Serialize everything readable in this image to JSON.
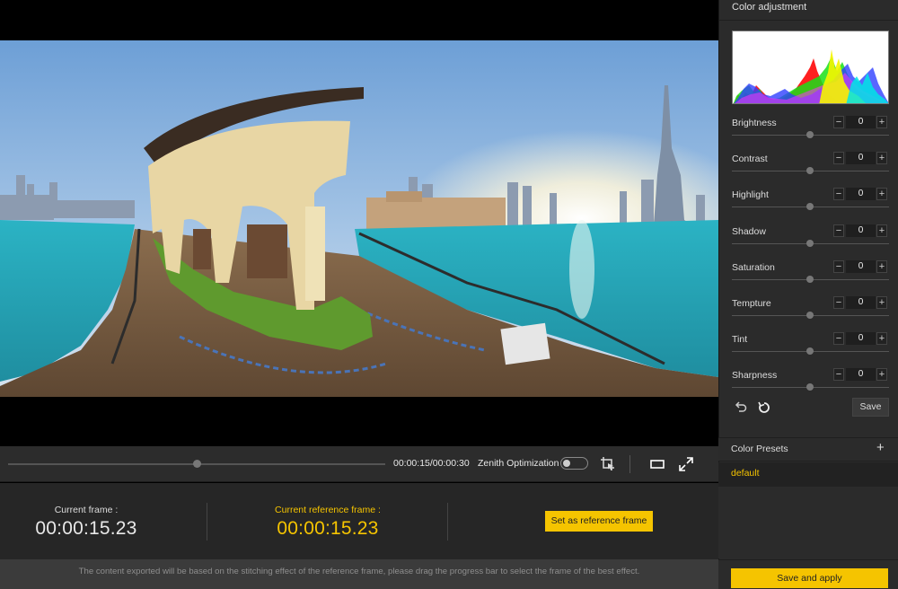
{
  "player": {
    "timecode": "00:00:15/00:00:30",
    "progress_fraction": 0.5,
    "zenith_label": "Zenith Optimization",
    "zenith_enabled": false
  },
  "frames": {
    "current_label": "Current frame :",
    "current_time": "00:00:15.23",
    "reference_label": "Current reference frame :",
    "reference_time": "00:00:15.23",
    "set_reference_button": "Set as reference frame"
  },
  "notice": "The content exported will be based on the stitching effect of the reference frame, please drag the progress bar to select the frame of the best effect.",
  "color_adjustment": {
    "title": "Color adjustment",
    "controls": [
      {
        "label": "Brightness",
        "value": "0"
      },
      {
        "label": "Contrast",
        "value": "0"
      },
      {
        "label": "Highlight",
        "value": "0"
      },
      {
        "label": "Shadow",
        "value": "0"
      },
      {
        "label": "Saturation",
        "value": "0"
      },
      {
        "label": "Tempture",
        "value": "0"
      },
      {
        "label": "Tint",
        "value": "0"
      },
      {
        "label": "Sharpness",
        "value": "0"
      }
    ],
    "minus_symbol": "−",
    "plus_symbol": "+",
    "save_button": "Save"
  },
  "color_presets": {
    "title": "Color Presets",
    "add_symbol": "+",
    "items": [
      "default"
    ]
  },
  "save_apply_button": "Save and apply",
  "colors": {
    "accent": "#f5c400",
    "panel": "#2b2b2b",
    "water": "#2aa8b8",
    "sky": "#7fb0e0"
  },
  "icons": [
    "crop-select-icon",
    "screen-icon",
    "fullscreen-icon",
    "undo-icon",
    "reset-icon"
  ]
}
